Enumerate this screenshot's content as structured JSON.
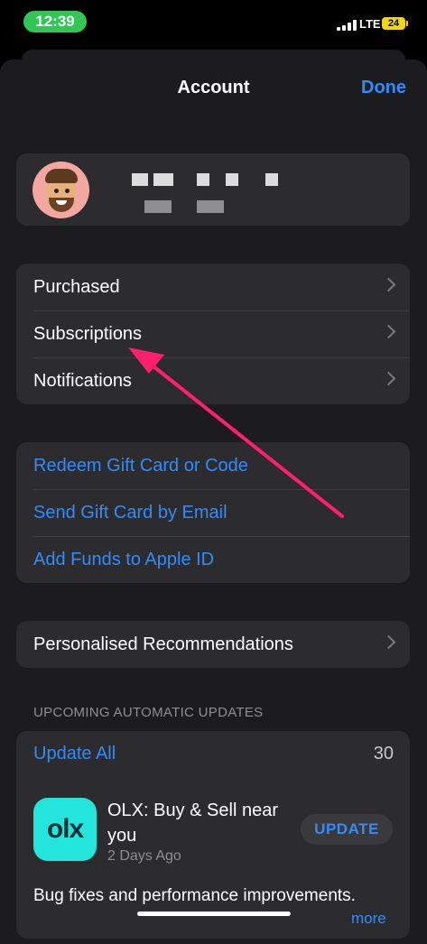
{
  "status_bar": {
    "time": "12:39",
    "network": "LTE",
    "battery": "24"
  },
  "header": {
    "title": "Account",
    "done_label": "Done"
  },
  "menu": {
    "items": [
      {
        "label": "Purchased"
      },
      {
        "label": "Subscriptions"
      },
      {
        "label": "Notifications"
      }
    ]
  },
  "links": {
    "items": [
      {
        "label": "Redeem Gift Card or Code"
      },
      {
        "label": "Send Gift Card by Email"
      },
      {
        "label": "Add Funds to Apple ID"
      }
    ]
  },
  "recommendations": {
    "label": "Personalised Recommendations"
  },
  "updates": {
    "section_title": "UPCOMING AUTOMATIC UPDATES",
    "update_all_label": "Update All",
    "count": "30",
    "app": {
      "icon_text": "olx",
      "name": "OLX: Buy & Sell near you",
      "age": "2 Days Ago",
      "button_label": "UPDATE",
      "notes": "Bug fixes and performance improvements.",
      "more_label": "more"
    }
  },
  "colors": {
    "accent": "#2f8cff",
    "arrow": "#ff1f6b",
    "pill": "#30c755"
  },
  "icons": [
    "chevron-right-icon",
    "signal-icon",
    "battery-icon",
    "avatar-memoji"
  ]
}
